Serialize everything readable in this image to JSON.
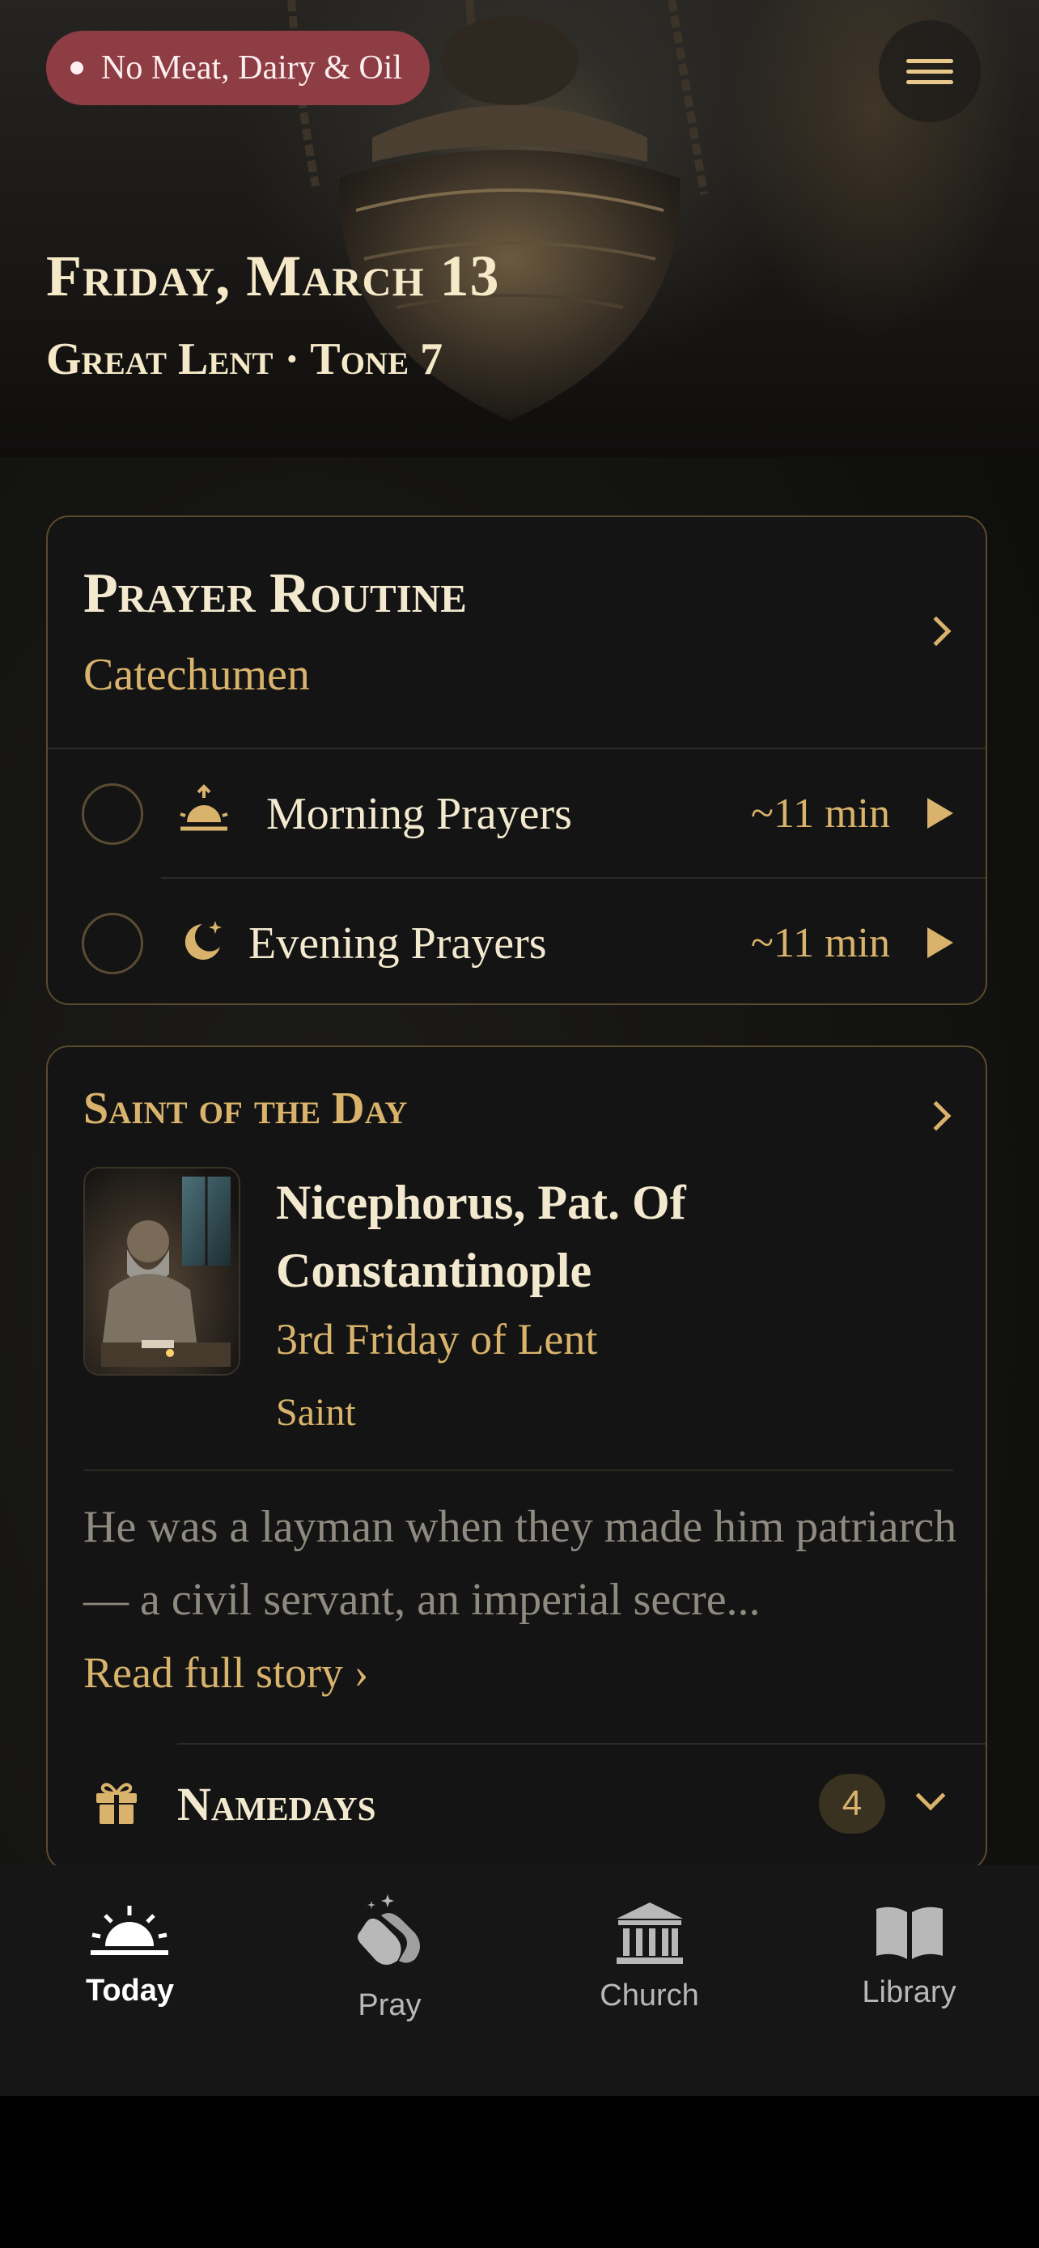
{
  "header": {
    "fast_label": "No Meat, Dairy & Oil",
    "menu_icon": "hamburger-menu-icon",
    "date_title": "Friday, March 13",
    "date_subtitle": "Great Lent · Tone 7"
  },
  "prayer_routine": {
    "title": "Prayer Routine",
    "subtitle": "Catechumen",
    "items": [
      {
        "label": "Morning Prayers",
        "duration": "~11 min",
        "icon": "sunrise-icon",
        "completed": false
      },
      {
        "label": "Evening Prayers",
        "duration": "~11 min",
        "icon": "moon-stars-icon",
        "completed": false
      }
    ]
  },
  "saint_of_day": {
    "heading": "Saint of the Day",
    "name": "Nicephorus, Pat. Of Constantinople",
    "feast": "3rd Friday of Lent",
    "type": "Saint",
    "story": "He was a layman when they made him patriarch — a civil servant, an imperial secre...",
    "read_more": "Read full story ›"
  },
  "namedays": {
    "label": "Namedays",
    "count": "4",
    "icon": "gift-icon"
  },
  "tabs": [
    {
      "label": "Today",
      "icon": "sunrise-icon",
      "active": true
    },
    {
      "label": "Pray",
      "icon": "praying-hands-icon",
      "active": false
    },
    {
      "label": "Church",
      "icon": "church-building-icon",
      "active": false
    },
    {
      "label": "Library",
      "icon": "open-book-icon",
      "active": false
    }
  ],
  "colors": {
    "accent_gold": "#d9b36c",
    "fast_badge": "#8f3d45",
    "card_bg": "#141414",
    "text_cream": "#f3e9cf"
  }
}
